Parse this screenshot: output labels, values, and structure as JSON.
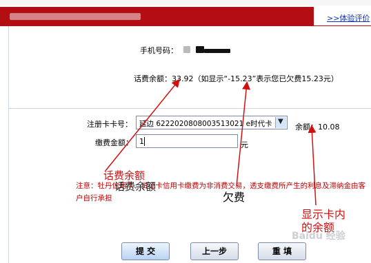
{
  "header": {
    "eval_link": ">>体验评价"
  },
  "form": {
    "phone_label": "手机号码：",
    "balance_text": "话费余额：33.92（如显示“-15.23”表示您已欠费15.23元）",
    "card_label": "注册卡卡号：",
    "card_select": "延边 6222020808003513021 e时代卡",
    "card_balance": "余额：10.08",
    "amount_label": "缴费金额：",
    "amount_value": "1",
    "amount_unit": "元"
  },
  "notice": "注意：牡丹信用卡、贷记卡信用卡缴费为非消费交易，透支缴费所产生的利息及滞纳金由客户自行承担",
  "buttons": {
    "submit": "提 交",
    "prev": "上一步",
    "reset": "重 填"
  },
  "annotations": {
    "phone_balance": "话费余额",
    "overlap": "话费余额",
    "debt": "欠费",
    "card_balance_line1": "显示卡内",
    "card_balance_line2": "的余额"
  },
  "watermark": "Baidu 经验",
  "colors": {
    "header_red": "#b20e14",
    "annotation_red": "#d01010",
    "link_blue": "#1030c0",
    "notice_red": "#c00000"
  }
}
